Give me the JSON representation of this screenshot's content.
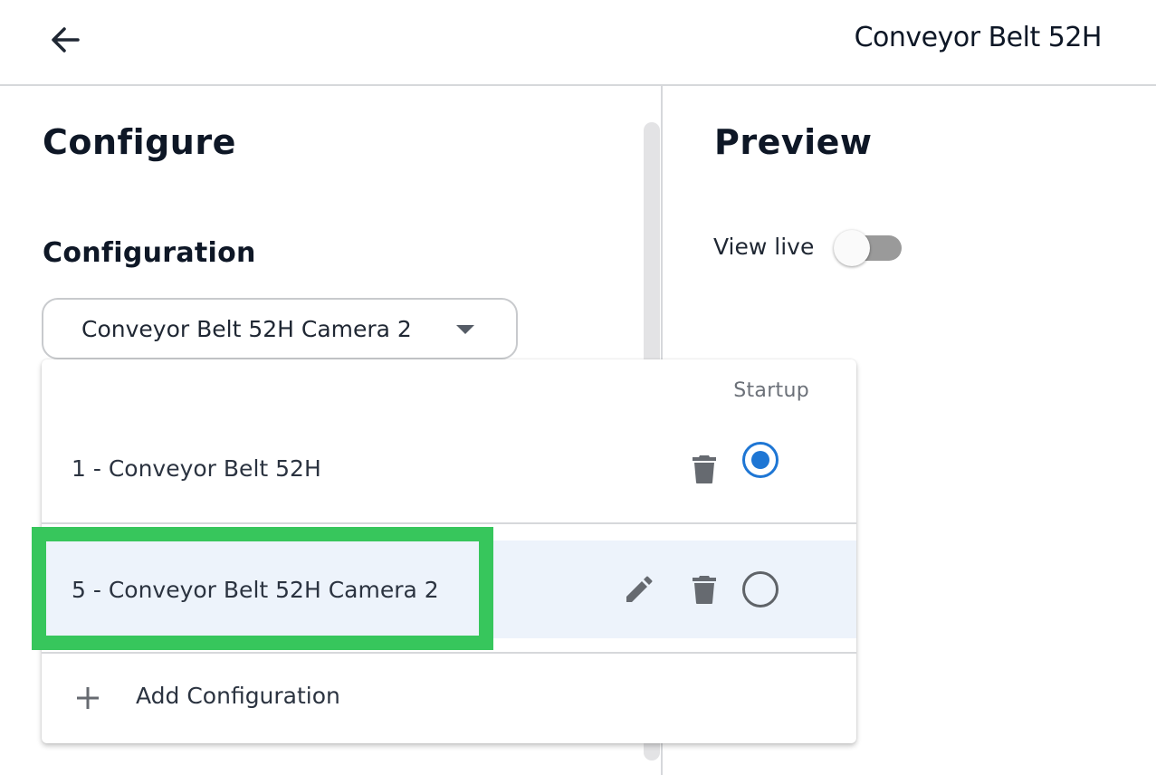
{
  "header": {
    "title": "Conveyor Belt 52H",
    "back_icon": "arrow-left-icon"
  },
  "configure": {
    "title": "Configure",
    "section_label": "Configuration",
    "selected_value": "Conveyor Belt 52H Camera 2",
    "dropdown": {
      "startup_header": "Startup",
      "options": [
        {
          "label": "1 - Conveyor Belt 52H",
          "startup_selected": true,
          "editable": false
        },
        {
          "label": "5 - Conveyor Belt 52H Camera 2",
          "startup_selected": false,
          "editable": true,
          "highlighted": true
        }
      ],
      "add_label": "Add Configuration"
    }
  },
  "preview": {
    "title": "Preview",
    "view_live_label": "View live",
    "view_live_on": false
  },
  "colors": {
    "accent_radio": "#1e76d4",
    "highlight_box": "#37c65c",
    "selected_row_bg": "#edf3fb"
  }
}
